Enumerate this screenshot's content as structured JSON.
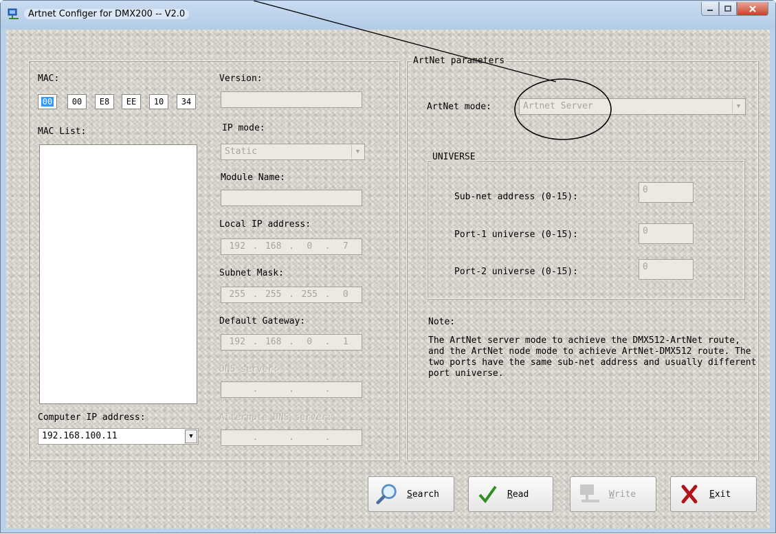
{
  "window": {
    "title": "Artnet Configer for DMX200 -- V2.0"
  },
  "left": {
    "mac_label": "MAC:",
    "mac_octets": [
      "00",
      "00",
      "E8",
      "EE",
      "10",
      "34"
    ],
    "mac_list_label": "MAC List:",
    "computer_ip_label": "Computer IP address:",
    "computer_ip_value": "192.168.100.11"
  },
  "mid": {
    "version_label": "Version:",
    "ip_mode_label": "IP mode:",
    "ip_mode_value": "Static",
    "module_name_label": "Module Name:",
    "local_ip_label": "Local IP address:",
    "local_ip": [
      "192",
      "168",
      "0",
      "7"
    ],
    "subnet_label": "Subnet Mask:",
    "subnet": [
      "255",
      "255",
      "255",
      "0"
    ],
    "gateway_label": "Default Gateway:",
    "gateway": [
      "192",
      "168",
      "0",
      "1"
    ],
    "dns_label": "DNS server:",
    "alt_dns_label": "Alternate DNS server:"
  },
  "artnet": {
    "group_title": "ArtNet parameters",
    "mode_label": "ArtNet mode:",
    "mode_value": "Artnet Server",
    "universe_title": "UNIVERSE",
    "subnet_label": "Sub-net address (0-15):",
    "subnet_value": "0",
    "port1_label": "Port-1 universe (0-15):",
    "port1_value": "0",
    "port2_label": "Port-2 universe (0-15):",
    "port2_value": "0",
    "note_label": "Note:",
    "note_text": "The ArtNet server mode to achieve the DMX512-ArtNet route, and the ArtNet node mode to achieve ArtNet-DMX512 route. The two ports have the same sub-net address and usually different port universe."
  },
  "buttons": {
    "search_u": "S",
    "search_rest": "earch",
    "read_u": "R",
    "read_rest": "ead",
    "write_u": "W",
    "write_rest": "rite",
    "exit_u": "E",
    "exit_rest": "xit"
  }
}
